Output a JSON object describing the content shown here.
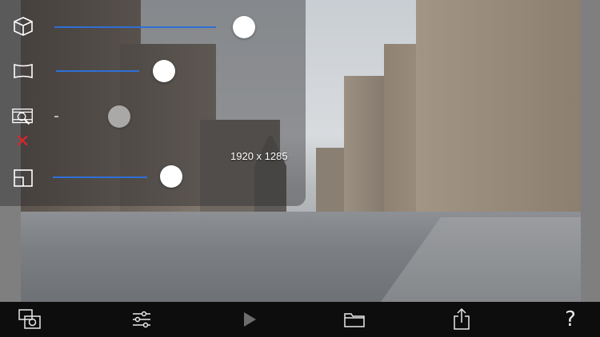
{
  "photo": {
    "resolution_label": "1920 x 1285",
    "description_scene": "street"
  },
  "controls": {
    "slider1_value": 0.78,
    "slider2_value": 0.44,
    "slider3_value": 0.25,
    "slider4_value": 0.47,
    "slider3_enabled": false
  },
  "toolbar": {
    "help_label": "?"
  },
  "icons": {
    "tool1": "cube-icon",
    "tool2": "panorama-icon",
    "tool3": "film-search-icon",
    "tool4": "crop-frame-icon",
    "delete": "x-icon",
    "bottom1": "photos-camera-icon",
    "bottom2": "sliders-icon",
    "bottom3": "play-icon",
    "bottom4": "folder-icon",
    "bottom5": "share-icon"
  },
  "colors": {
    "slider_track": "#2f6fd6",
    "delete_red": "#e0242a",
    "toolbar_bg": "#0d0d0d"
  }
}
